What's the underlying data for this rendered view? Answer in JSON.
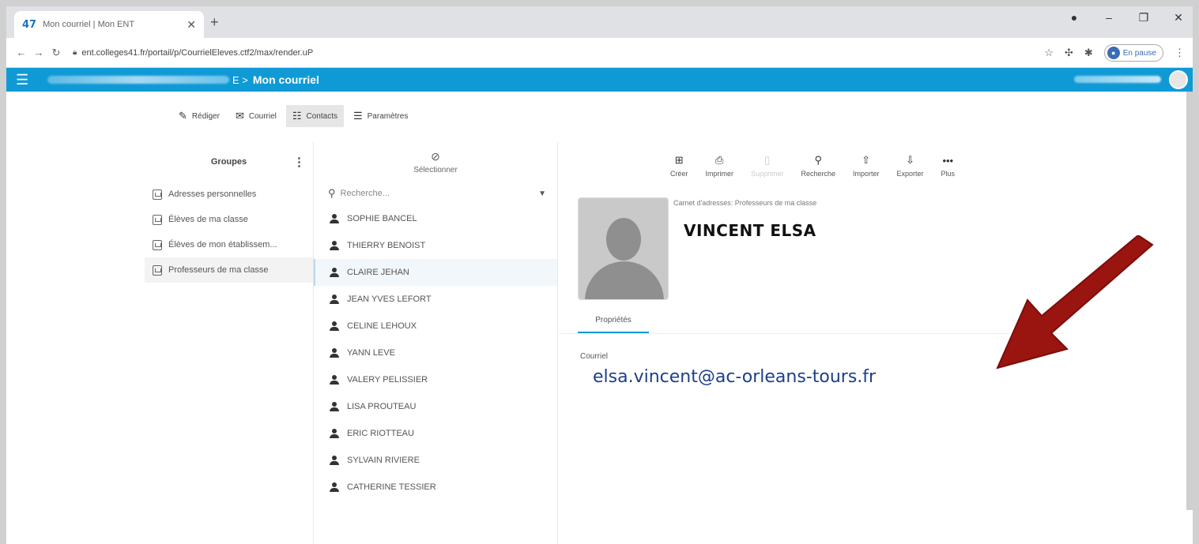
{
  "browser": {
    "tab_title": "Mon courriel | Mon ENT",
    "tab_favicon": "47",
    "url": "ent.colleges41.fr/portail/p/CourrielEleves.ctf2/max/render.uP",
    "profile_status": "En pause"
  },
  "header": {
    "breadcrumb_tail": "E >",
    "title": "Mon courriel"
  },
  "app_tabs": [
    {
      "label": "Rédiger",
      "icon": "compose-icon"
    },
    {
      "label": "Courriel",
      "icon": "envelope-icon"
    },
    {
      "label": "Contacts",
      "icon": "contacts-icon"
    },
    {
      "label": "Paramètres",
      "icon": "settings-icon"
    }
  ],
  "groups": {
    "header": "Groupes",
    "items": [
      "Adresses personnelles",
      "Élèves de ma classe",
      "Élèves de mon établissem...",
      "Professeurs de ma classe"
    ]
  },
  "list": {
    "select_label": "Sélectionner",
    "search_placeholder": "Recherche...",
    "contacts": [
      "SOPHIE BANCEL",
      "THIERRY BENOIST",
      "CLAIRE JEHAN",
      "JEAN YVES LEFORT",
      "CELINE LEHOUX",
      "YANN LEVE",
      "VALERY PELISSIER",
      "LISA PROUTEAU",
      "ERIC RIOTTEAU",
      "SYLVAIN RIVIERE",
      "CATHERINE TESSIER"
    ]
  },
  "actions": [
    {
      "label": "Créer",
      "icon": "add-icon"
    },
    {
      "label": "Imprimer",
      "icon": "print-icon"
    },
    {
      "label": "Supprimer",
      "icon": "trash-icon"
    },
    {
      "label": "Recherche",
      "icon": "search-icon"
    },
    {
      "label": "Importer",
      "icon": "upload-icon"
    },
    {
      "label": "Exporter",
      "icon": "download-icon"
    },
    {
      "label": "Plus",
      "icon": "more-icon"
    }
  ],
  "detail": {
    "address_book": "Carnet d'adresses: Professeurs de ma classe",
    "name": "VINCENT ELSA",
    "properties_tab": "Propriétés",
    "email_label": "Courriel",
    "email": "elsa.vincent@ac-orleans-tours.fr"
  },
  "colors": {
    "header_blue": "#0f9ad6",
    "email_blue": "#1b3f8a",
    "arrow_red": "#9a1410"
  }
}
